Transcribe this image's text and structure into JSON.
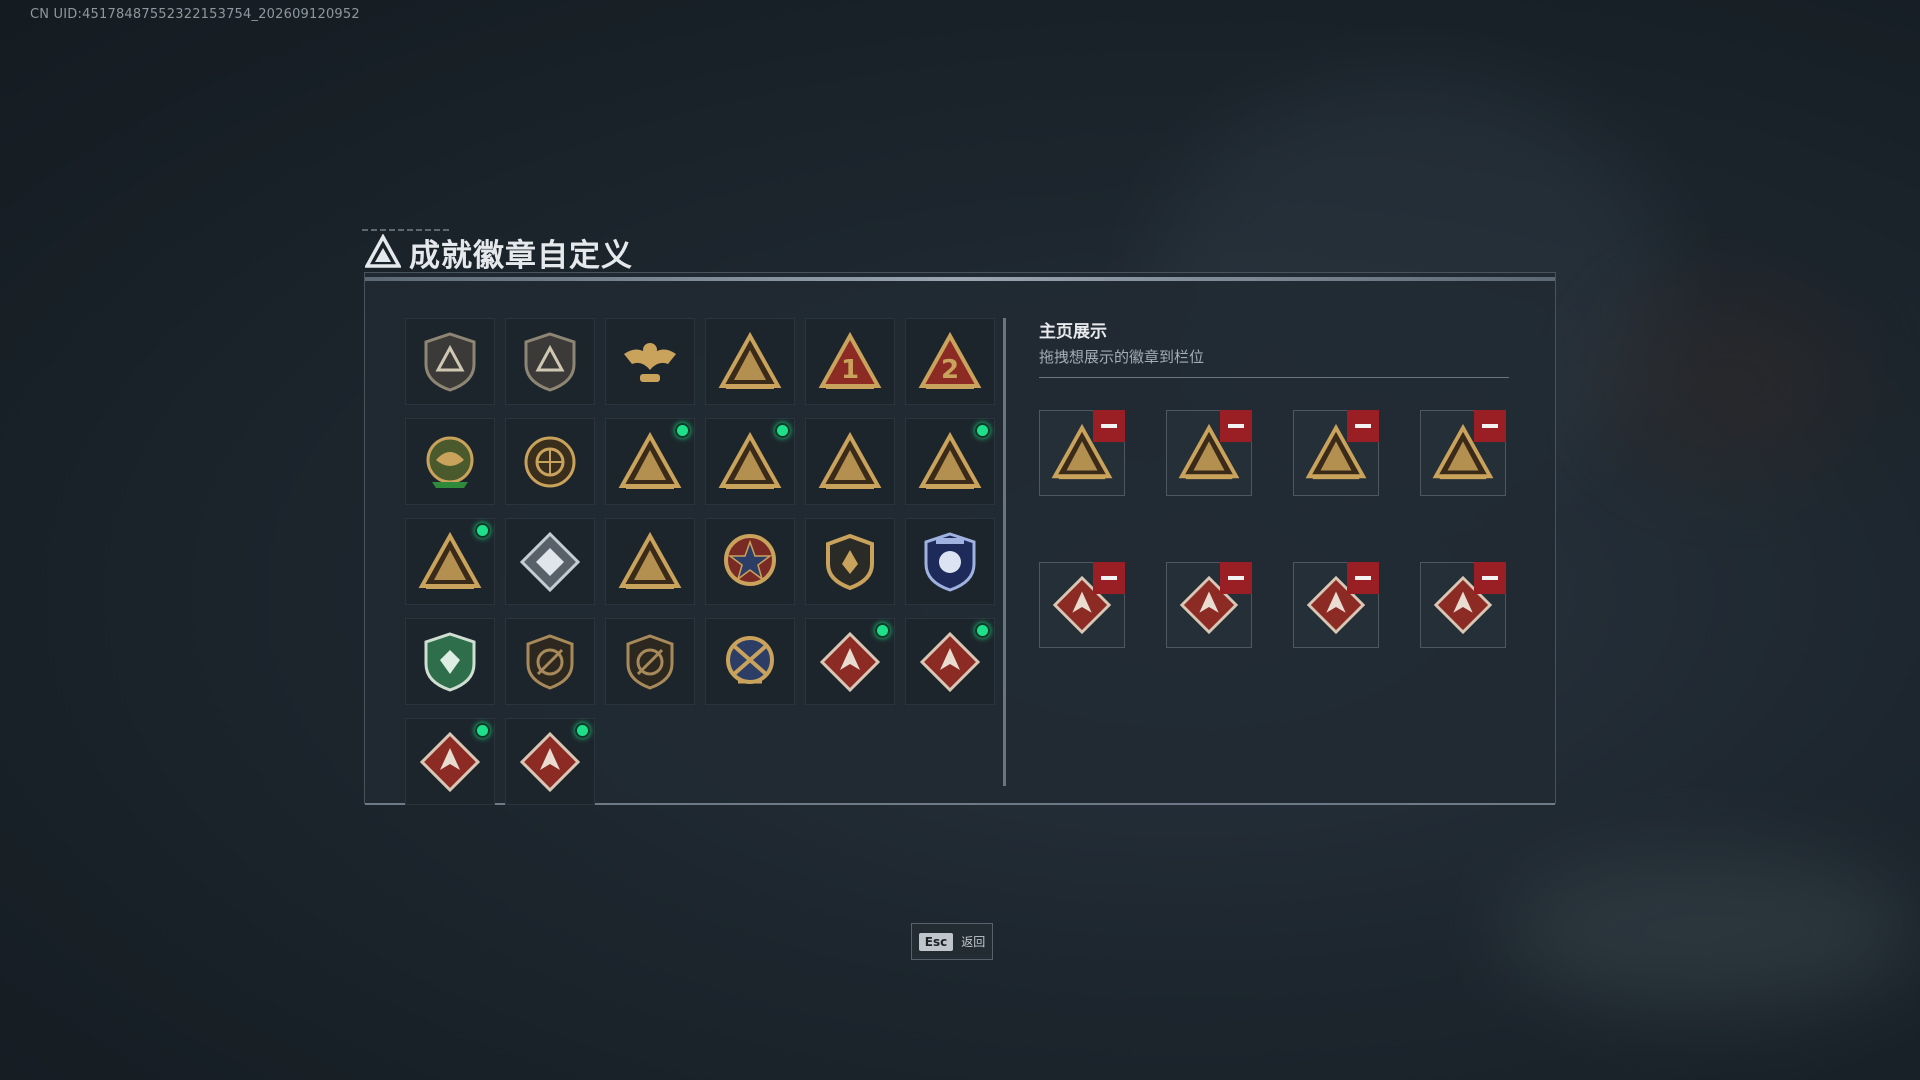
{
  "uid_text": "CN UID:451784875523221537​54_202609120952",
  "title": "成就徽章自定义",
  "showcase": {
    "title": "主页展示",
    "subtitle": "拖拽想展示的徽章到栏位"
  },
  "badges": [
    {
      "icon": "delta-shield-badge-icon",
      "style": "shield-dark",
      "new": false
    },
    {
      "icon": "helicopter-shield-badge-icon",
      "style": "shield-dark",
      "new": false
    },
    {
      "icon": "eagle-badge-icon",
      "style": "eagle",
      "new": false
    },
    {
      "icon": "tent-triangle-badge-icon",
      "style": "tri-gold",
      "new": false
    },
    {
      "icon": "rank-1-triangle-badge-icon",
      "style": "tri-red",
      "label": "1",
      "new": false
    },
    {
      "icon": "rank-2-triangle-badge-icon",
      "style": "tri-red",
      "label": "2",
      "new": false
    },
    {
      "icon": "dragon-emblem-badge-icon",
      "style": "emblem-green",
      "new": false
    },
    {
      "icon": "globe-emblem-badge-icon",
      "style": "emblem-gold",
      "new": false
    },
    {
      "icon": "soldier-triangle-badge-icon",
      "style": "tri-gold",
      "new": true
    },
    {
      "icon": "hexagon-triangle-badge-icon",
      "style": "tri-gold",
      "new": true
    },
    {
      "icon": "squad-triangle-badge-icon",
      "style": "tri-gold",
      "new": false
    },
    {
      "icon": "rocket-triangle-badge-icon",
      "style": "tri-gold",
      "new": true
    },
    {
      "icon": "wave-triangle-badge-icon",
      "style": "tri-gold",
      "new": true
    },
    {
      "icon": "silver-diamond-badge-icon",
      "style": "diamond-silver",
      "new": false
    },
    {
      "icon": "extinguisher-triangle-badge-icon",
      "style": "tri-gold",
      "new": false
    },
    {
      "icon": "star-medal-badge-icon",
      "style": "medal-star",
      "new": false
    },
    {
      "icon": "crest-shield-badge-icon",
      "style": "shield-gold",
      "new": false
    },
    {
      "icon": "blue-police-badge-icon",
      "style": "shield-blue",
      "new": false
    },
    {
      "icon": "green-shield-badge-icon",
      "style": "shield-green",
      "new": false
    },
    {
      "icon": "rifle-shield-badge-icon",
      "style": "shield-bronze",
      "new": false
    },
    {
      "icon": "rifle-shield-alt-badge-icon",
      "style": "shield-bronze",
      "new": false
    },
    {
      "icon": "crossed-medal-badge-icon",
      "style": "medal-cross",
      "new": false
    },
    {
      "icon": "wolf-diamond-badge-icon",
      "style": "diamond-red",
      "new": true
    },
    {
      "icon": "dragon-diamond-badge-icon",
      "style": "diamond-red",
      "new": true
    },
    {
      "icon": "runner-diamond-badge-icon",
      "style": "diamond-red",
      "new": true
    },
    {
      "icon": "wrench-diamond-badge-icon",
      "style": "diamond-red",
      "new": true
    }
  ],
  "slots": [
    {
      "icon": "rocket-triangle-badge-icon",
      "style": "tri-gold"
    },
    {
      "icon": "soldier-triangle-badge-icon",
      "style": "tri-gold"
    },
    {
      "icon": "wave-triangle-badge-icon",
      "style": "tri-gold"
    },
    {
      "icon": "hexagon-triangle-badge-icon",
      "style": "tri-gold"
    },
    {
      "icon": "wrench-diamond-badge-icon",
      "style": "diamond-red"
    },
    {
      "icon": "wolf-diamond-badge-icon",
      "style": "diamond-red"
    },
    {
      "icon": "dragon-diamond-badge-icon",
      "style": "diamond-red"
    },
    {
      "icon": "runner-diamond-badge-icon",
      "style": "diamond-red"
    }
  ],
  "esc": {
    "key": "Esc",
    "label": "返回"
  },
  "colors": {
    "gold": "#c9a25b",
    "red": "#8c2a24",
    "new_dot": "#1fe08a",
    "remove": "#9a1f25"
  }
}
